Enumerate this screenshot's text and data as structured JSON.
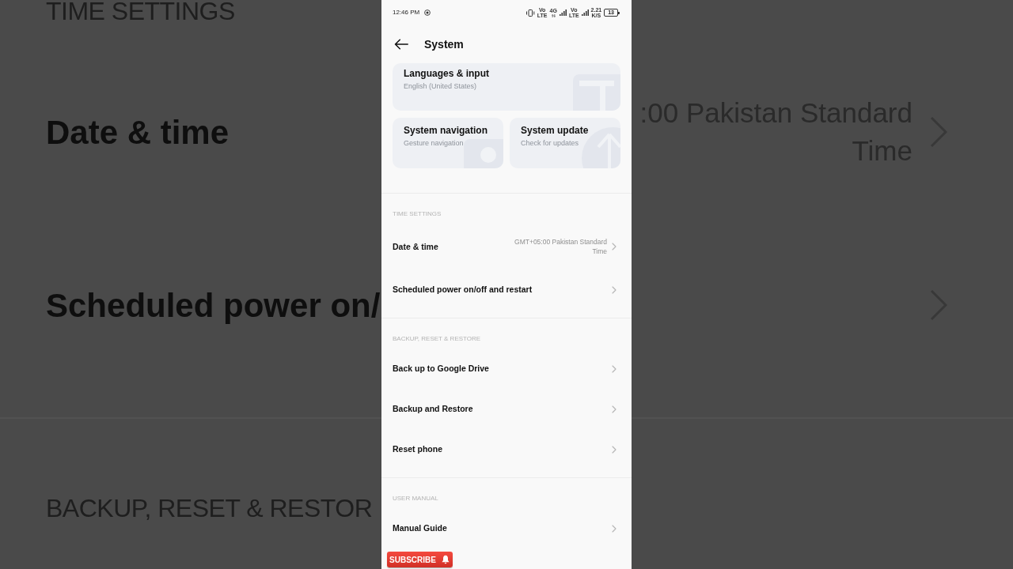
{
  "backdrop": {
    "left": {
      "section": "TIME SETTINGS",
      "rows": [
        "Date & time",
        "Scheduled power on/"
      ],
      "next_section": "BACKUP, RESET & RESTOR"
    },
    "right": {
      "rows": [
        {
          "value": ":00 Pakistan Standard Time",
          "arrow": true
        },
        {
          "arrow": true
        }
      ]
    }
  },
  "status_bar": {
    "time": "12:46 PM",
    "indicators": [
      {
        "kind": "vibrate"
      },
      {
        "kind": "volte",
        "lines": [
          "Vo",
          "LTE"
        ]
      },
      {
        "kind": "data",
        "lines": [
          "4G"
        ]
      },
      {
        "kind": "signal"
      },
      {
        "kind": "volte",
        "lines": [
          "Vo",
          "LTE"
        ]
      },
      {
        "kind": "signal"
      },
      {
        "kind": "speed",
        "lines": [
          "2.21",
          "K/S"
        ]
      }
    ],
    "battery": "13"
  },
  "header": {
    "title": "System"
  },
  "cards": [
    {
      "kind": "language",
      "title": "Languages & input",
      "subtitle": "English (United States)"
    },
    {
      "kind": "navigation",
      "title": "System navigation",
      "subtitle": "Gesture navigation"
    },
    {
      "kind": "update",
      "title": "System update",
      "subtitle": "Check for updates"
    }
  ],
  "sections": [
    {
      "header": "TIME SETTINGS",
      "items": [
        {
          "label": "Date & time",
          "value": "GMT+05:00 Pakistan Standard Time"
        },
        {
          "label": "Scheduled power on/off and restart"
        }
      ]
    },
    {
      "header": "BACKUP, RESET & RESTORE",
      "items": [
        {
          "label": "Back up to Google Drive"
        },
        {
          "label": "Backup and Restore"
        },
        {
          "label": "Reset phone"
        }
      ]
    },
    {
      "header": "USER MANUAL",
      "items": [
        {
          "label": "Manual Guide"
        }
      ]
    }
  ],
  "subscribe": {
    "label": "SUBSCRIBE"
  }
}
